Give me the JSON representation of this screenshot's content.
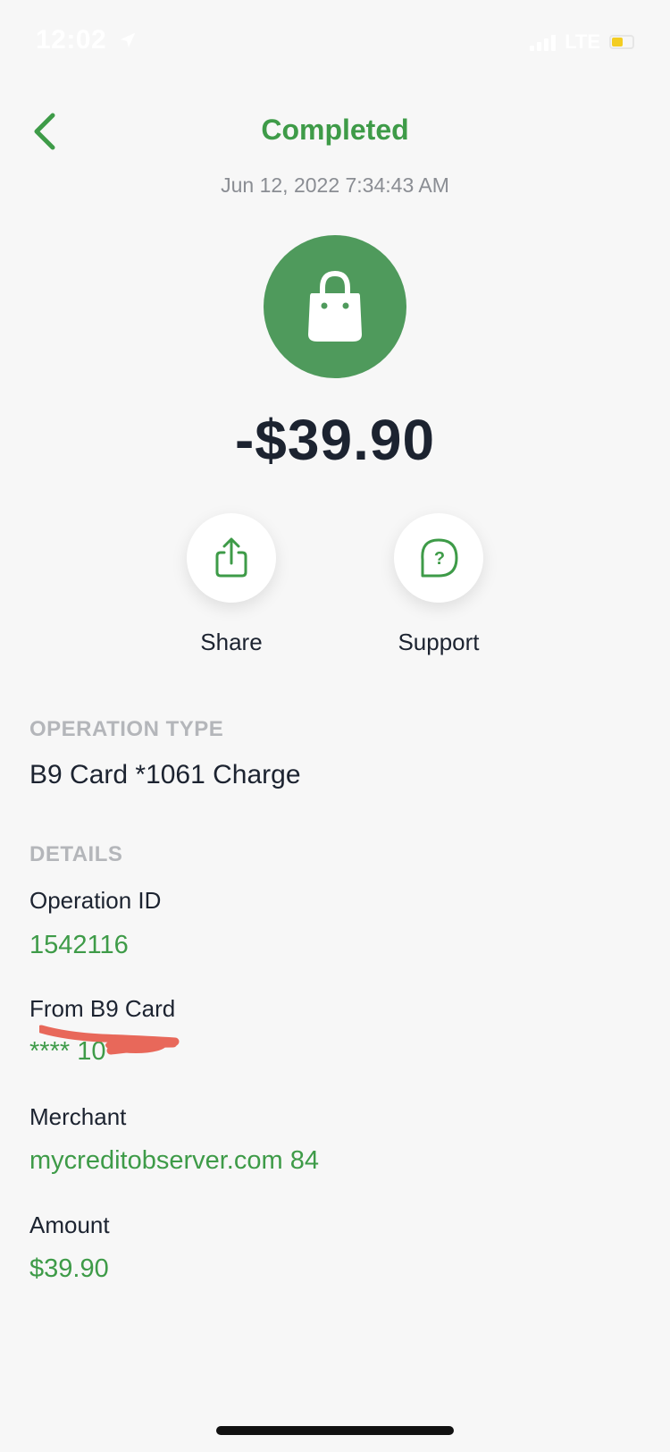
{
  "status_bar": {
    "time": "12:02",
    "network": "LTE"
  },
  "header": {
    "title": "Completed",
    "timestamp": "Jun 12, 2022 7:34:43 AM"
  },
  "transaction": {
    "amount_display": "-$39.90",
    "icon": "shopping-bag-icon"
  },
  "actions": [
    {
      "label": "Share",
      "icon": "share-icon"
    },
    {
      "label": "Support",
      "icon": "question-bubble-icon"
    }
  ],
  "operation_type": {
    "section_title": "OPERATION TYPE",
    "value": "B9 Card *1061 Charge"
  },
  "details": {
    "section_title": "DETAILS",
    "operation_id_label": "Operation ID",
    "operation_id_value": "1542116",
    "from_card_label": "From B9 Card",
    "from_card_value": "**** 10",
    "merchant_label": "Merchant",
    "merchant_value": "mycreditobserver.com 84",
    "amount_label": "Amount",
    "amount_value": "$39.90"
  },
  "colors": {
    "accent_green": "#3e9b48",
    "avatar_green": "#4f9a5c",
    "redaction_red": "#e8685a",
    "background": "#f7f7f7"
  }
}
